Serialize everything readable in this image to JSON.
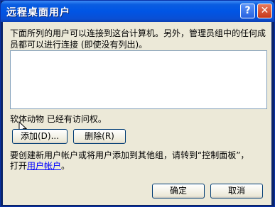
{
  "window": {
    "title": "远程桌面用户",
    "help_label": "?",
    "close_label": "✕"
  },
  "description": "下面所列的用户可以连接到这台计算机。另外，管理员组中的任何成员都可以进行连接 (即使没有列出)。",
  "user_list": [],
  "status_text": "软体动物 已经有访问权。",
  "buttons": {
    "add": "添加(D)...",
    "remove": "删除(R)",
    "ok": "确定",
    "cancel": "取消"
  },
  "info": {
    "line1": "要创建新用户帐户或将用户添加到其他组，请转到“控制面板”，",
    "line2_prefix": "打开",
    "link": "用户帐户",
    "line2_suffix": "。"
  }
}
